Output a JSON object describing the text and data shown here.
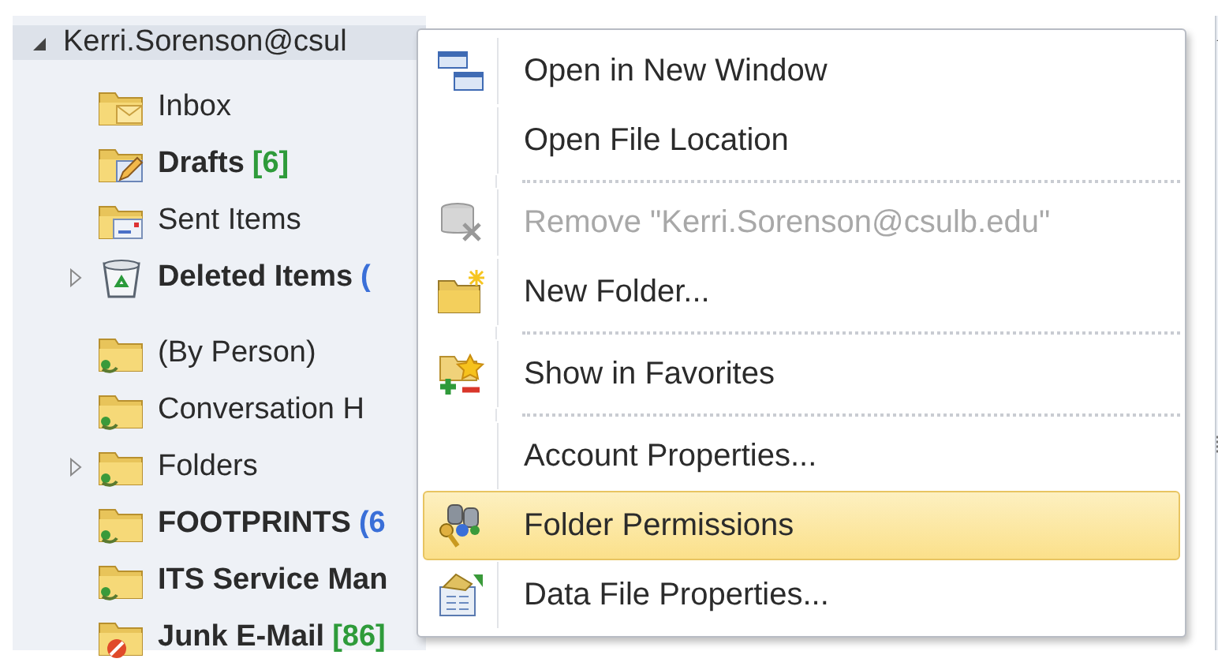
{
  "folder_pane": {
    "account": {
      "label": "Kerri.Sorenson@csul",
      "expanded": true
    },
    "groups": [
      [
        {
          "label": "Inbox",
          "kind": "inbox",
          "bold": false,
          "has_children": false
        },
        {
          "label": "Drafts",
          "count": "[6]",
          "color": "#2e9b3a",
          "kind": "drafts",
          "bold": true,
          "has_children": false
        },
        {
          "label": "Sent Items",
          "kind": "sent",
          "bold": false,
          "has_children": false
        },
        {
          "label": "Deleted Items",
          "count": "(",
          "color": "#3a6fd8",
          "kind": "trash",
          "bold": true,
          "has_children": true
        }
      ],
      [
        {
          "label": "(By Person)",
          "kind": "shared",
          "bold": false,
          "has_children": false
        },
        {
          "label": "Conversation H",
          "kind": "shared",
          "bold": false,
          "has_children": false
        },
        {
          "label": "Folders",
          "kind": "shared",
          "bold": false,
          "has_children": true
        },
        {
          "label": "FOOTPRINTS",
          "count": "(6",
          "color": "#3a6fd8",
          "kind": "shared",
          "bold": true,
          "has_children": false
        },
        {
          "label": "ITS Service Man",
          "kind": "shared",
          "bold": true,
          "has_children": false
        },
        {
          "label": "Junk E-Mail",
          "count": "[86]",
          "color": "#2e9b3a",
          "kind": "junk",
          "bold": true,
          "has_children": false
        }
      ]
    ]
  },
  "context_menu": {
    "items": [
      {
        "kind": "windows",
        "label": "Open in New Window",
        "disabled": false,
        "selected": false
      },
      {
        "kind": "plain",
        "label": "Open File Location",
        "disabled": false,
        "selected": false
      },
      {
        "kind": "separator"
      },
      {
        "kind": "remove",
        "label": "Remove \"Kerri.Sorenson@csulb.edu\"",
        "disabled": true,
        "selected": false
      },
      {
        "kind": "newfolder",
        "label": "New Folder...",
        "disabled": false,
        "selected": false
      },
      {
        "kind": "separator"
      },
      {
        "kind": "favorites",
        "label": "Show in Favorites",
        "disabled": false,
        "selected": false
      },
      {
        "kind": "separator"
      },
      {
        "kind": "plain",
        "label": "Account Properties...",
        "disabled": false,
        "selected": false
      },
      {
        "kind": "permissions",
        "label": "Folder Permissions",
        "disabled": false,
        "selected": true
      },
      {
        "kind": "datafile",
        "label": "Data File Properties...",
        "disabled": false,
        "selected": false
      }
    ]
  }
}
